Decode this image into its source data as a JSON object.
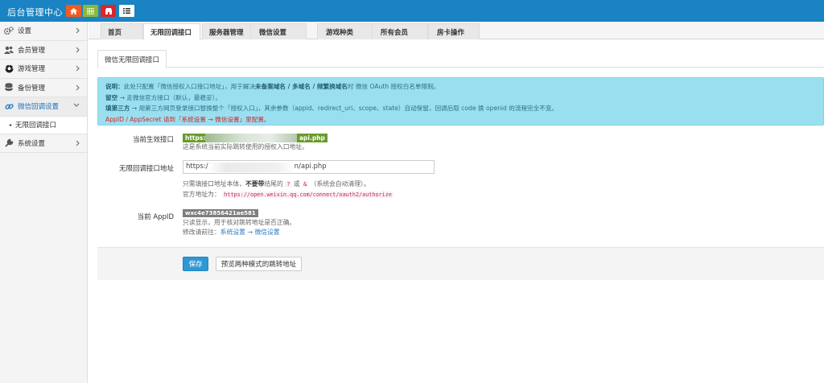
{
  "header": {
    "brand": "后台管理中心",
    "buttons": [
      {
        "icon": "home-icon",
        "color": "#f15b22"
      },
      {
        "icon": "grid-icon",
        "color": "#8bb83a"
      },
      {
        "icon": "store-icon",
        "color": "#d9262b"
      },
      {
        "icon": "list-icon",
        "color": "#ffffff"
      }
    ]
  },
  "sidebar": {
    "items": [
      {
        "label": "设置",
        "icon": "gears-icon"
      },
      {
        "label": "会员管理",
        "icon": "users-icon"
      },
      {
        "label": "游戏管理",
        "icon": "soccer-ball-icon"
      },
      {
        "label": "备份管理",
        "icon": "database-icon"
      },
      {
        "label": "微信回调设置",
        "icon": "link-icon"
      },
      {
        "label": "系统设置",
        "icon": "wrench-icon"
      }
    ],
    "sub_item": "无限回调接口"
  },
  "tabs": [
    "首页",
    "无限回调接口",
    "服务器管理",
    "微信设置",
    "游戏种类",
    "所有会员",
    "房卡操作"
  ],
  "panel": {
    "subtab": "微信无限回调接口",
    "notice": {
      "l1_a": "说明：",
      "l1_b": "此处只配置「微信授权入口接口地址」，用于解决",
      "l1_c": "未备案域名 / 多域名 / 频繁换域名",
      "l1_d": "时 微信 OAuth 授权白名单限制。",
      "l2_a": "留空",
      "l2_b": " → 走微信官方接口（默认，最稳妥）。",
      "l3_a": "填第三方",
      "l3_b": " → 用第三方网页登录接口替换整个「授权入口」，其余参数（appid、redirect_uri、scope、state）自动保留，回调后取 code 换 openid 的流程完全不变。",
      "l4": "AppID / AppSecret 请到「系统设置 → 微信设置」里配置。"
    },
    "current": {
      "label": "当前生效接口",
      "url_start": "https:/",
      "url_end": "api.php",
      "hint": "这是系统当前实际跳转使用的授权入口地址。"
    },
    "callback": {
      "label": "无限回调接口地址",
      "value_start": "https:/",
      "value_end": "n/api.php",
      "hint1_a": "只需填接口地址本体，",
      "hint1_b": "不要带",
      "hint1_c": "结尾的",
      "code_q": "?",
      "hint1_or": "或",
      "code_amp": "&",
      "hint1_d": "（系统会自动清理）。",
      "hint2": "官方地址为：",
      "official_url": "https://open.weixin.qq.com/connect/oauth2/authorize"
    },
    "appid": {
      "label": "当前 AppID",
      "value": "wxc4e73856421ae581",
      "hint1": "只读显示，用于核对跳转地址是否正确。",
      "hint2": "修改请前往：",
      "link": "系统设置 → 微信设置"
    },
    "save_label": "保存",
    "preview_label": "预览两种模式的跳转地址"
  }
}
